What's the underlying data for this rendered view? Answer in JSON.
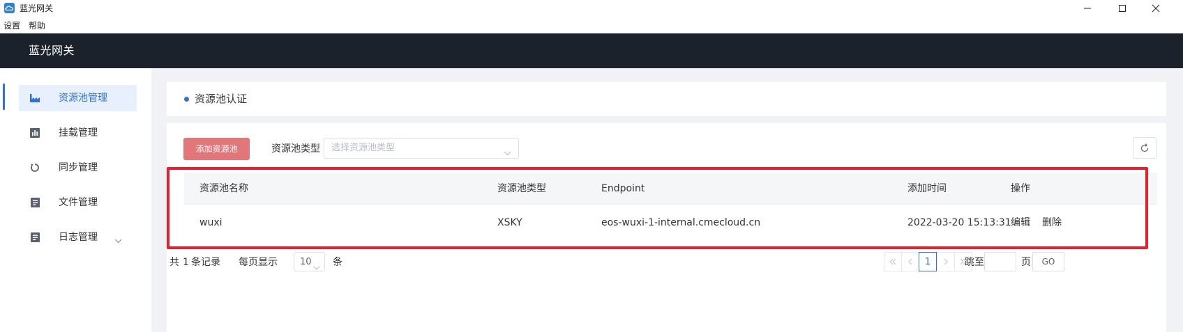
{
  "window": {
    "title": "蓝光网关",
    "icon": "cloud-app-icon",
    "controls": [
      "minimize-icon",
      "maximize-icon",
      "close-icon"
    ]
  },
  "menubar": {
    "items": [
      "设置",
      "帮助"
    ]
  },
  "header": {
    "title": "蓝光网关"
  },
  "sidebar": {
    "items": [
      {
        "label": "资源池管理",
        "icon": "factory-icon",
        "active": true
      },
      {
        "label": "挂载管理",
        "icon": "bar-chart-icon",
        "active": false
      },
      {
        "label": "同步管理",
        "icon": "sync-icon",
        "active": false
      },
      {
        "label": "文件管理",
        "icon": "document-icon",
        "active": false
      },
      {
        "label": "日志管理",
        "icon": "log-icon",
        "active": false,
        "expandable": true
      }
    ]
  },
  "section": {
    "title": "资源池认证"
  },
  "toolbar": {
    "add_label": "添加资源池",
    "filter_label": "资源池类型",
    "select_placeholder": "选择资源池类型"
  },
  "table": {
    "columns": [
      "资源池名称",
      "资源池类型",
      "Endpoint",
      "添加时间",
      "操作"
    ],
    "rows": [
      {
        "name": "wuxi",
        "type": "XSKY",
        "endpoint": "eos-wuxi-1-internal.cmecloud.cn",
        "added": "2022-03-20 15:13:31",
        "actions": [
          "编辑",
          "删除"
        ]
      }
    ]
  },
  "pagination": {
    "total_prefix": "共",
    "total": "1",
    "total_suffix": "条记录",
    "page_size_label": "每页显示",
    "page_size": "10",
    "page_size_unit": "条",
    "current_page": "1",
    "jump_label": "跳至",
    "page_unit": "页",
    "go_label": "GO"
  },
  "colors": {
    "accent": "#2f6fe0",
    "header_bg": "#1c222b",
    "add_button": "#e37678",
    "highlight": "#e8202b"
  }
}
